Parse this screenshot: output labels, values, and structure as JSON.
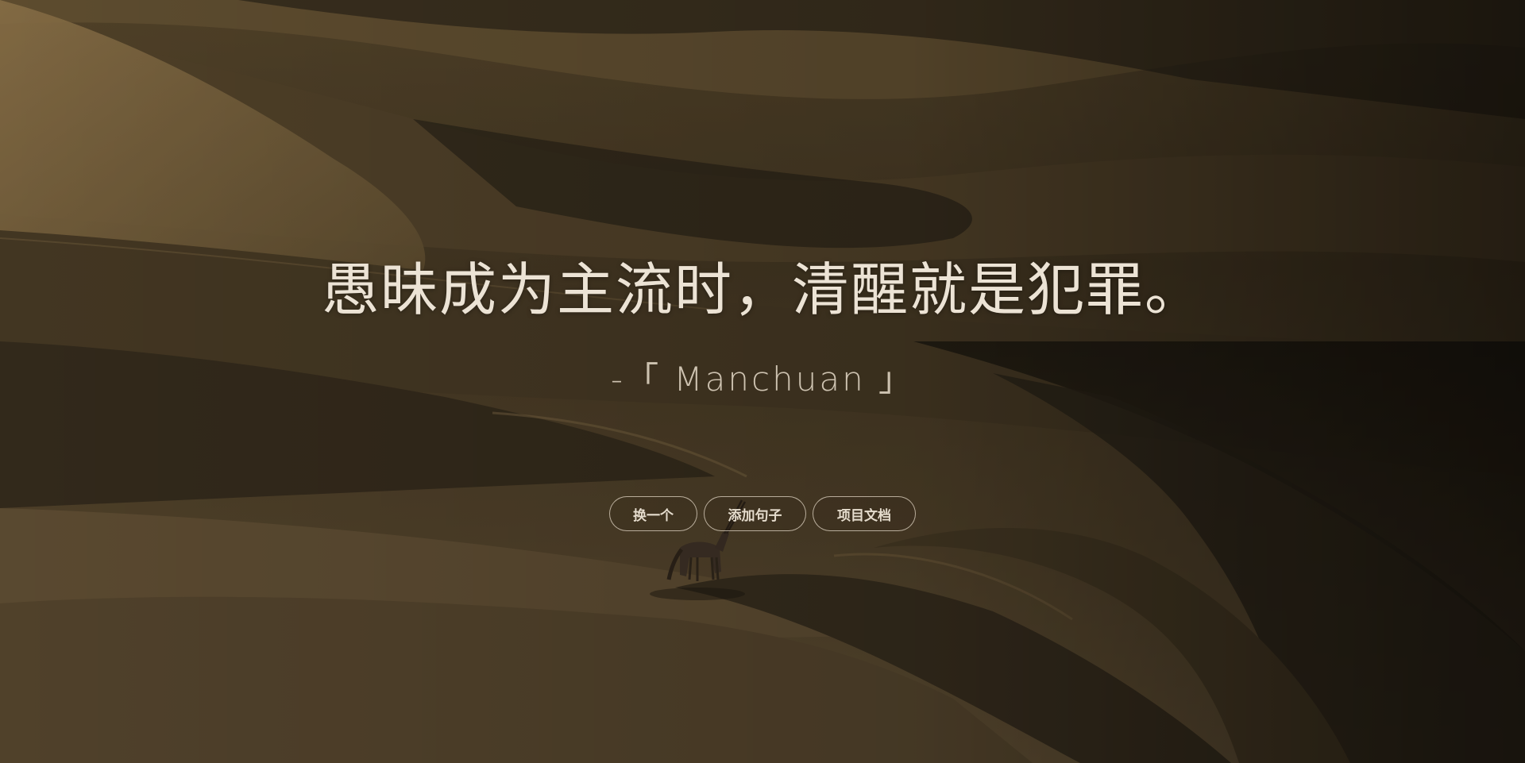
{
  "background": {
    "scene": "desert-dunes-oryx",
    "colors": {
      "dark": "#1d1912",
      "mid": "#5a4b30",
      "light": "#8e7549",
      "sand": "#a88a56"
    }
  },
  "quote": {
    "text": "愚昧成为主流时，清醒就是犯罪。",
    "author": "-「 Manchuan 」"
  },
  "buttons": [
    {
      "label": "换一个"
    },
    {
      "label": "添加句子"
    },
    {
      "label": "项目文档"
    }
  ]
}
